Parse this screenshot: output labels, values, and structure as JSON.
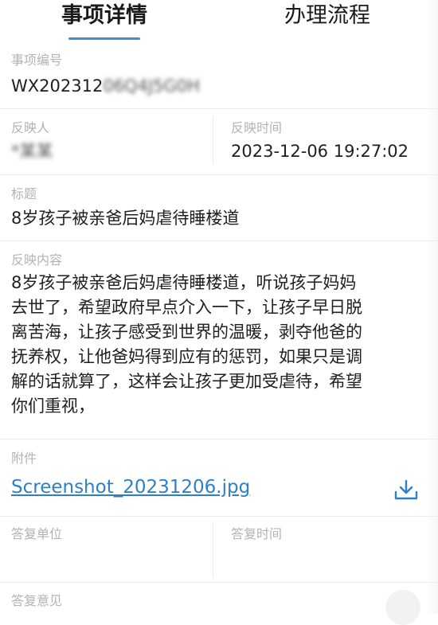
{
  "tabs": [
    {
      "label": "事项详情",
      "active": true
    },
    {
      "label": "办理流程",
      "active": false
    }
  ],
  "item_number": {
    "label": "事项编号",
    "value_visible": "WX202312",
    "value_obscured": "06Q4J5G0H"
  },
  "reporter": {
    "label": "反映人",
    "value_obscured": "*某某"
  },
  "report_time": {
    "label": "反映时间",
    "value": "2023-12-06 19:27:02"
  },
  "title": {
    "label": "标题",
    "value": "8岁孩子被亲爸后妈虐待睡楼道"
  },
  "content": {
    "label": "反映内容",
    "lines": [
      "8岁孩子被亲爸后妈虐待睡楼道，听说孩子妈妈",
      "去世了，希望政府早点介入一下，让孩子早日脱",
      "离苦海，让孩子感受到世界的温暖，剥夺他爸的",
      "抚养权，让他爸妈得到应有的惩罚，如果只是调",
      "解的话就算了，这样会让孩子更加受虐待，希望",
      "你们重视，"
    ]
  },
  "attachment": {
    "label": "附件",
    "filename": "Screenshot_20231206.jpg",
    "icon": "download-icon"
  },
  "reply_unit": {
    "label": "答复单位",
    "value": ""
  },
  "reply_time": {
    "label": "答复时间",
    "value": ""
  },
  "reply_opinion": {
    "label": "答复意见",
    "value": ""
  },
  "colors": {
    "accent": "#3a8fd6",
    "link": "#2f7fc8",
    "label": "#b3b3b3",
    "text": "#202020"
  }
}
